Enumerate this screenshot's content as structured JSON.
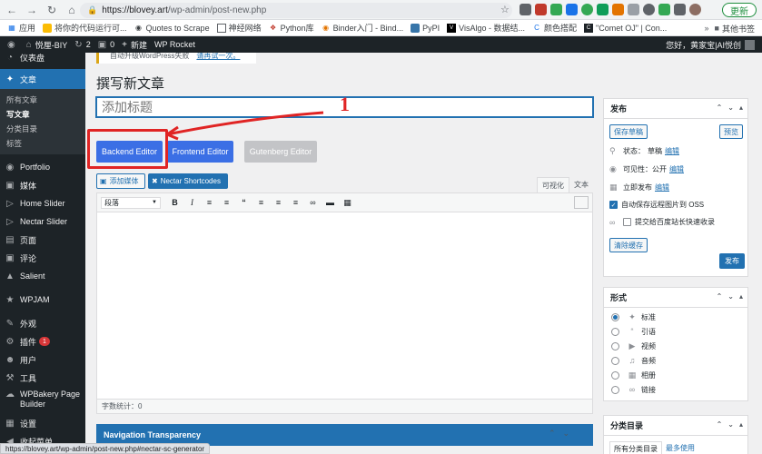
{
  "browser": {
    "url_host": "https://blovey.art",
    "url_path": "/wp-admin/post-new.php",
    "update_label": "更新",
    "bookmarks": [
      {
        "icon": "apps-icon",
        "label": "应用"
      },
      {
        "icon": "code-icon",
        "label": "将你的代码运行可..."
      },
      {
        "icon": "quotes-icon",
        "label": "Quotes to Scrape"
      },
      {
        "icon": "doc-icon",
        "label": "神经网络"
      },
      {
        "icon": "python-icon",
        "label": "Python库"
      },
      {
        "icon": "binder-icon",
        "label": "Binder入门 - Bind..."
      },
      {
        "icon": "pypi-icon",
        "label": "PyPI"
      },
      {
        "icon": "visualgo-icon",
        "label": "VisAlgo - 数据结..."
      },
      {
        "icon": "color-icon",
        "label": "颜色搭配"
      },
      {
        "icon": "oj-icon",
        "label": "\"Comet OJ\" | Con..."
      }
    ],
    "other_bookmarks": "其他书签",
    "status_url": "https://blovey.art/wp-admin/post-new.php#nectar-sc-generator"
  },
  "adminbar": {
    "site_name": "悦厘-BIY",
    "updates": "2",
    "comments": "0",
    "new_label": "新建",
    "rocket_label": "WP Rocket",
    "greeting": "您好，黄家宝|AI悦创"
  },
  "sidebar": {
    "items": [
      {
        "icon": "dashboard-icon",
        "label": "仪表盘"
      },
      {
        "icon": "pin-icon",
        "label": "文章"
      },
      {
        "icon": "portfolio-icon",
        "label": "Portfolio"
      },
      {
        "icon": "media-icon",
        "label": "媒体"
      },
      {
        "icon": "slider-icon",
        "label": "Home Slider"
      },
      {
        "icon": "slider-icon",
        "label": "Nectar Slider"
      },
      {
        "icon": "page-icon",
        "label": "页面"
      },
      {
        "icon": "comment-icon",
        "label": "评论"
      },
      {
        "icon": "salient-icon",
        "label": "Salient"
      },
      {
        "icon": "wpjam-icon",
        "label": "WPJAM"
      },
      {
        "icon": "appearance-icon",
        "label": "外观"
      },
      {
        "icon": "plugin-icon",
        "label": "插件",
        "badge": "1"
      },
      {
        "icon": "users-icon",
        "label": "用户"
      },
      {
        "icon": "tools-icon",
        "label": "工具"
      },
      {
        "icon": "wpbakery-icon",
        "label": "WPBakery Page Builder"
      },
      {
        "icon": "settings-icon",
        "label": "设置"
      },
      {
        "icon": "collapse-icon",
        "label": "收起菜单"
      }
    ],
    "submenu": [
      "所有文章",
      "写文章",
      "分类目录",
      "标签"
    ]
  },
  "main": {
    "notice_text": "自动升级WordPress失败",
    "notice_link": "请再试一次。",
    "page_title": "撰写新文章",
    "title_placeholder": "添加标题",
    "backend_editor": "Backend Editor",
    "frontend_editor": "Frontend Editor",
    "gutenberg_editor": "Gutenberg Editor",
    "annotation_number": "1",
    "add_media": "添加媒体",
    "nectar_shortcodes": "Nectar Shortcodes",
    "tab_visual": "可视化",
    "tab_text": "文本",
    "format_select": "段落",
    "word_count": "字数统计：0",
    "nav_panel_title": "Navigation Transparency"
  },
  "publish_box": {
    "title": "发布",
    "save_draft": "保存草稿",
    "preview": "预览",
    "status_label": "状态：",
    "status_value": "草稿",
    "visibility_label": "可见性：",
    "visibility_value": "公开",
    "publish_time": "立即发布",
    "edit_link": "编辑",
    "oss_option": "自动保存远程图片到 OSS",
    "baidu_option": "提交给百度站长快速收录",
    "clear_cache": "清除缓存",
    "publish_button": "发布"
  },
  "format_box": {
    "title": "形式",
    "options": [
      {
        "icon": "pin-icon",
        "label": "标准",
        "selected": true
      },
      {
        "icon": "quote-icon",
        "label": "引语",
        "selected": false
      },
      {
        "icon": "video-icon",
        "label": "视频",
        "selected": false
      },
      {
        "icon": "audio-icon",
        "label": "音频",
        "selected": false
      },
      {
        "icon": "gallery-icon",
        "label": "相册",
        "selected": false
      },
      {
        "icon": "link-icon",
        "label": "链接",
        "selected": false
      }
    ]
  },
  "category_box": {
    "title": "分类目录",
    "tab_all": "所有分类目录",
    "tab_popular": "最多使用"
  },
  "colors": {
    "accent": "#2271b1",
    "annotation_red": "#e02424",
    "wpbakery_blue": "#3b6fe5",
    "admin_dark": "#1d2327"
  }
}
